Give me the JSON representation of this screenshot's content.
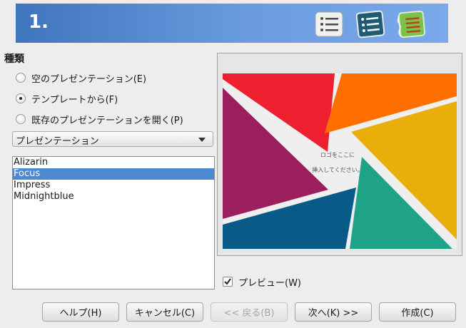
{
  "banner": {
    "step": "1."
  },
  "section": {
    "title": "種類"
  },
  "options": [
    {
      "label": "空のプレゼンテーション(E)",
      "checked": false
    },
    {
      "label": "テンプレートから(F)",
      "checked": true
    },
    {
      "label": "既存のプレゼンテーションを開く(P)",
      "checked": false
    }
  ],
  "category": {
    "value": "プレゼンテーション"
  },
  "templates": {
    "items": [
      "Alizarin",
      "Focus",
      "Impress",
      "Midnightblue"
    ],
    "selected": "Focus"
  },
  "preview": {
    "placeholder_line1": "ロゴをここに",
    "placeholder_line2": "挿入してください。"
  },
  "preview_toggle": {
    "label": "プレビュー(W)",
    "checked": true
  },
  "buttons": {
    "help": "ヘルプ(H)",
    "cancel": "キャンセル(C)",
    "back": "<< 戻る(B)",
    "next": "次へ(K) >>",
    "create": "作成(C)"
  },
  "colors": {
    "banner": "#5c8fd6",
    "selection": "#4b89d0",
    "focus_red": "#ee1f2f",
    "focus_orange": "#ff6f00",
    "focus_yellow": "#eaae0a",
    "focus_teal": "#1fa388",
    "focus_blue": "#075b86",
    "focus_magenta": "#9b1f5c"
  }
}
